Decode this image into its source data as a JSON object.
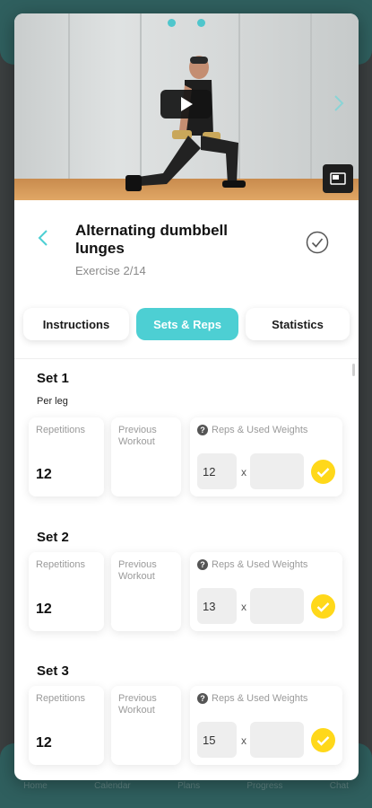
{
  "background_tabs": [
    "Home",
    "Calendar",
    "Plans",
    "Progress",
    "Chat"
  ],
  "video": {
    "carousel_dots": 2,
    "accent_color": "#4dcfd3"
  },
  "exercise": {
    "title": "Alternating dumbbell lunges",
    "subtitle": "Exercise 2/14"
  },
  "tabs": [
    {
      "label": "Instructions",
      "active": false
    },
    {
      "label": "Sets & Reps",
      "active": true
    },
    {
      "label": "Statistics",
      "active": false
    }
  ],
  "labels": {
    "repetitions": "Repetitions",
    "previous_workout": "Previous Workout",
    "reps_weights": "Reps & Used Weights",
    "times": "x"
  },
  "sets": [
    {
      "title": "Set 1",
      "note": "Per leg",
      "repetitions": "12",
      "reps_input": "12",
      "weight_input": ""
    },
    {
      "title": "Set 2",
      "note": "",
      "repetitions": "12",
      "reps_input": "13",
      "weight_input": ""
    },
    {
      "title": "Set 3",
      "note": "",
      "repetitions": "12",
      "reps_input": "15",
      "weight_input": ""
    }
  ]
}
